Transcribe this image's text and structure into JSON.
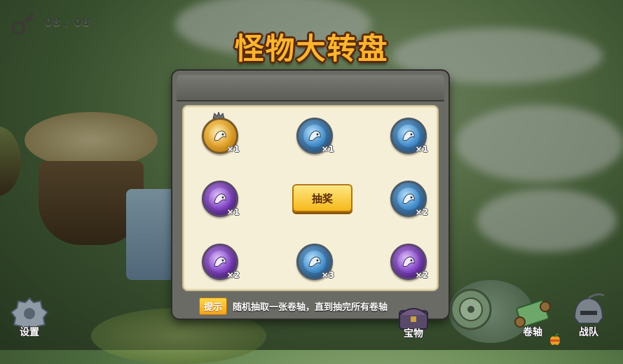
{
  "hud": {
    "key_count": "08 / 08"
  },
  "title": "怪物大转盘",
  "panel": {
    "draw_button_label": "抽奖",
    "hint_badge": "提示",
    "hint_text": "随机抽取一张卷轴，直到抽完所有卷轴",
    "slots": [
      {
        "color": "gold",
        "qty": "×1"
      },
      {
        "color": "blue",
        "qty": "×1"
      },
      {
        "color": "blue",
        "qty": "×1"
      },
      {
        "color": "purple",
        "qty": "×1"
      },
      {
        "color": "blue",
        "qty": "×2"
      },
      {
        "color": "purple",
        "qty": "×2"
      },
      {
        "color": "blue",
        "qty": "×3"
      },
      {
        "color": "purple",
        "qty": "×2"
      }
    ]
  },
  "bottom_nav": {
    "settings": "设置",
    "treasure": "宝物",
    "scroll": "卷轴",
    "team": "战队"
  },
  "colors": {
    "title": "#ffb52e",
    "button": "#f6b91c",
    "panel_body": "#f6efd7"
  }
}
